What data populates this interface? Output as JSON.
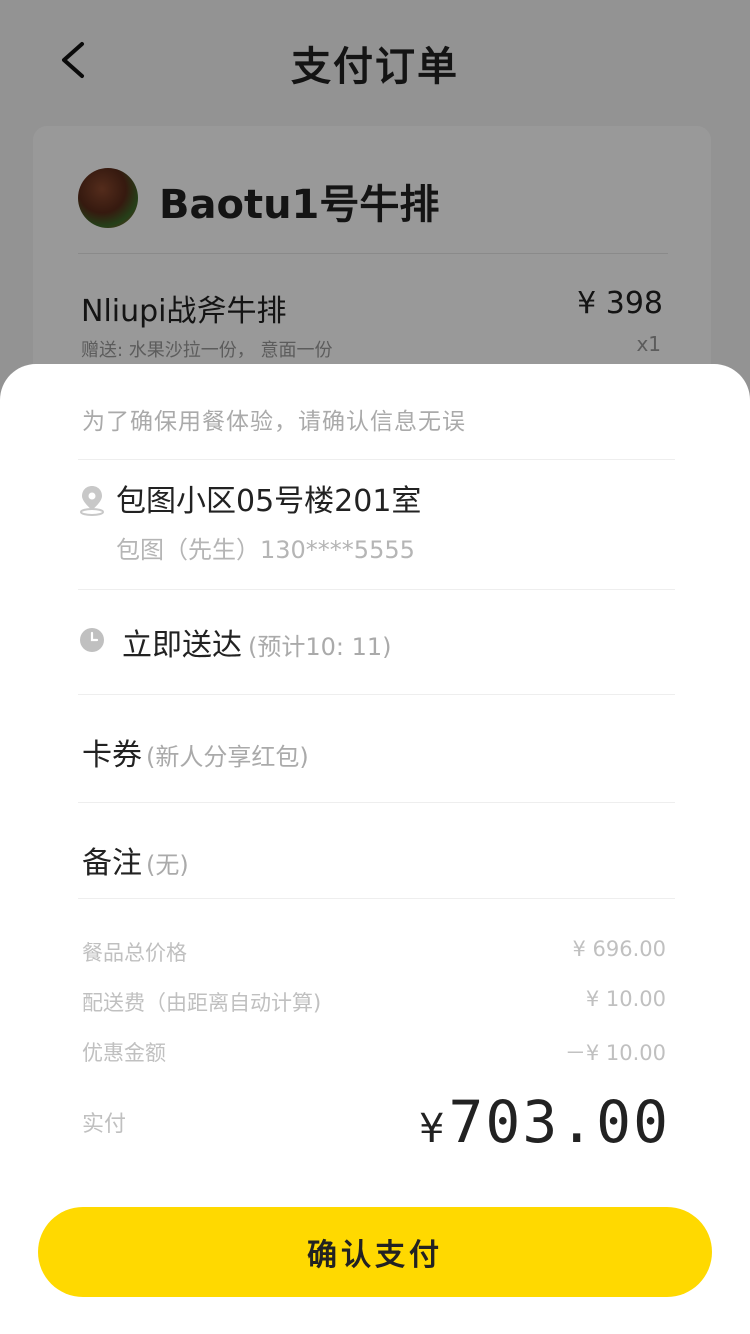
{
  "header": {
    "title": "支付订单",
    "back_icon": "chevron-left-icon"
  },
  "order": {
    "shop_name": "Baotu1号牛排",
    "dish": {
      "name": "Nliupi战斧牛排",
      "price": "¥ 398",
      "gift": "赠送: 水果沙拉一份， 意面一份",
      "qty": "x1"
    }
  },
  "sheet": {
    "tip": "为了确保用餐体验，请确认信息无误",
    "address": {
      "icon": "location-pin-icon",
      "main": "包图小区05号楼201室",
      "sub": "包图（先生）130****5555"
    },
    "delivery": {
      "icon": "clock-icon",
      "main": "立即送达",
      "sub": "(预计10: 11)"
    },
    "coupon": {
      "main": "卡券",
      "sub": "(新人分享红包)"
    },
    "note": {
      "main": "备注",
      "sub": "(无)"
    },
    "summary": [
      {
        "label": "餐品总价格",
        "value": "¥ 696.00"
      },
      {
        "label": "配送费（由距离自动计算)",
        "value": "¥ 10.00"
      },
      {
        "label": "优惠金额",
        "value": "－¥ 10.00"
      }
    ],
    "paid": {
      "label": "实付",
      "currency": "¥",
      "amount": "703.00"
    },
    "pay_button": "确认支付"
  },
  "colors": {
    "accent": "#ffd900",
    "overlay": "rgba(0,0,0,0.4)"
  }
}
